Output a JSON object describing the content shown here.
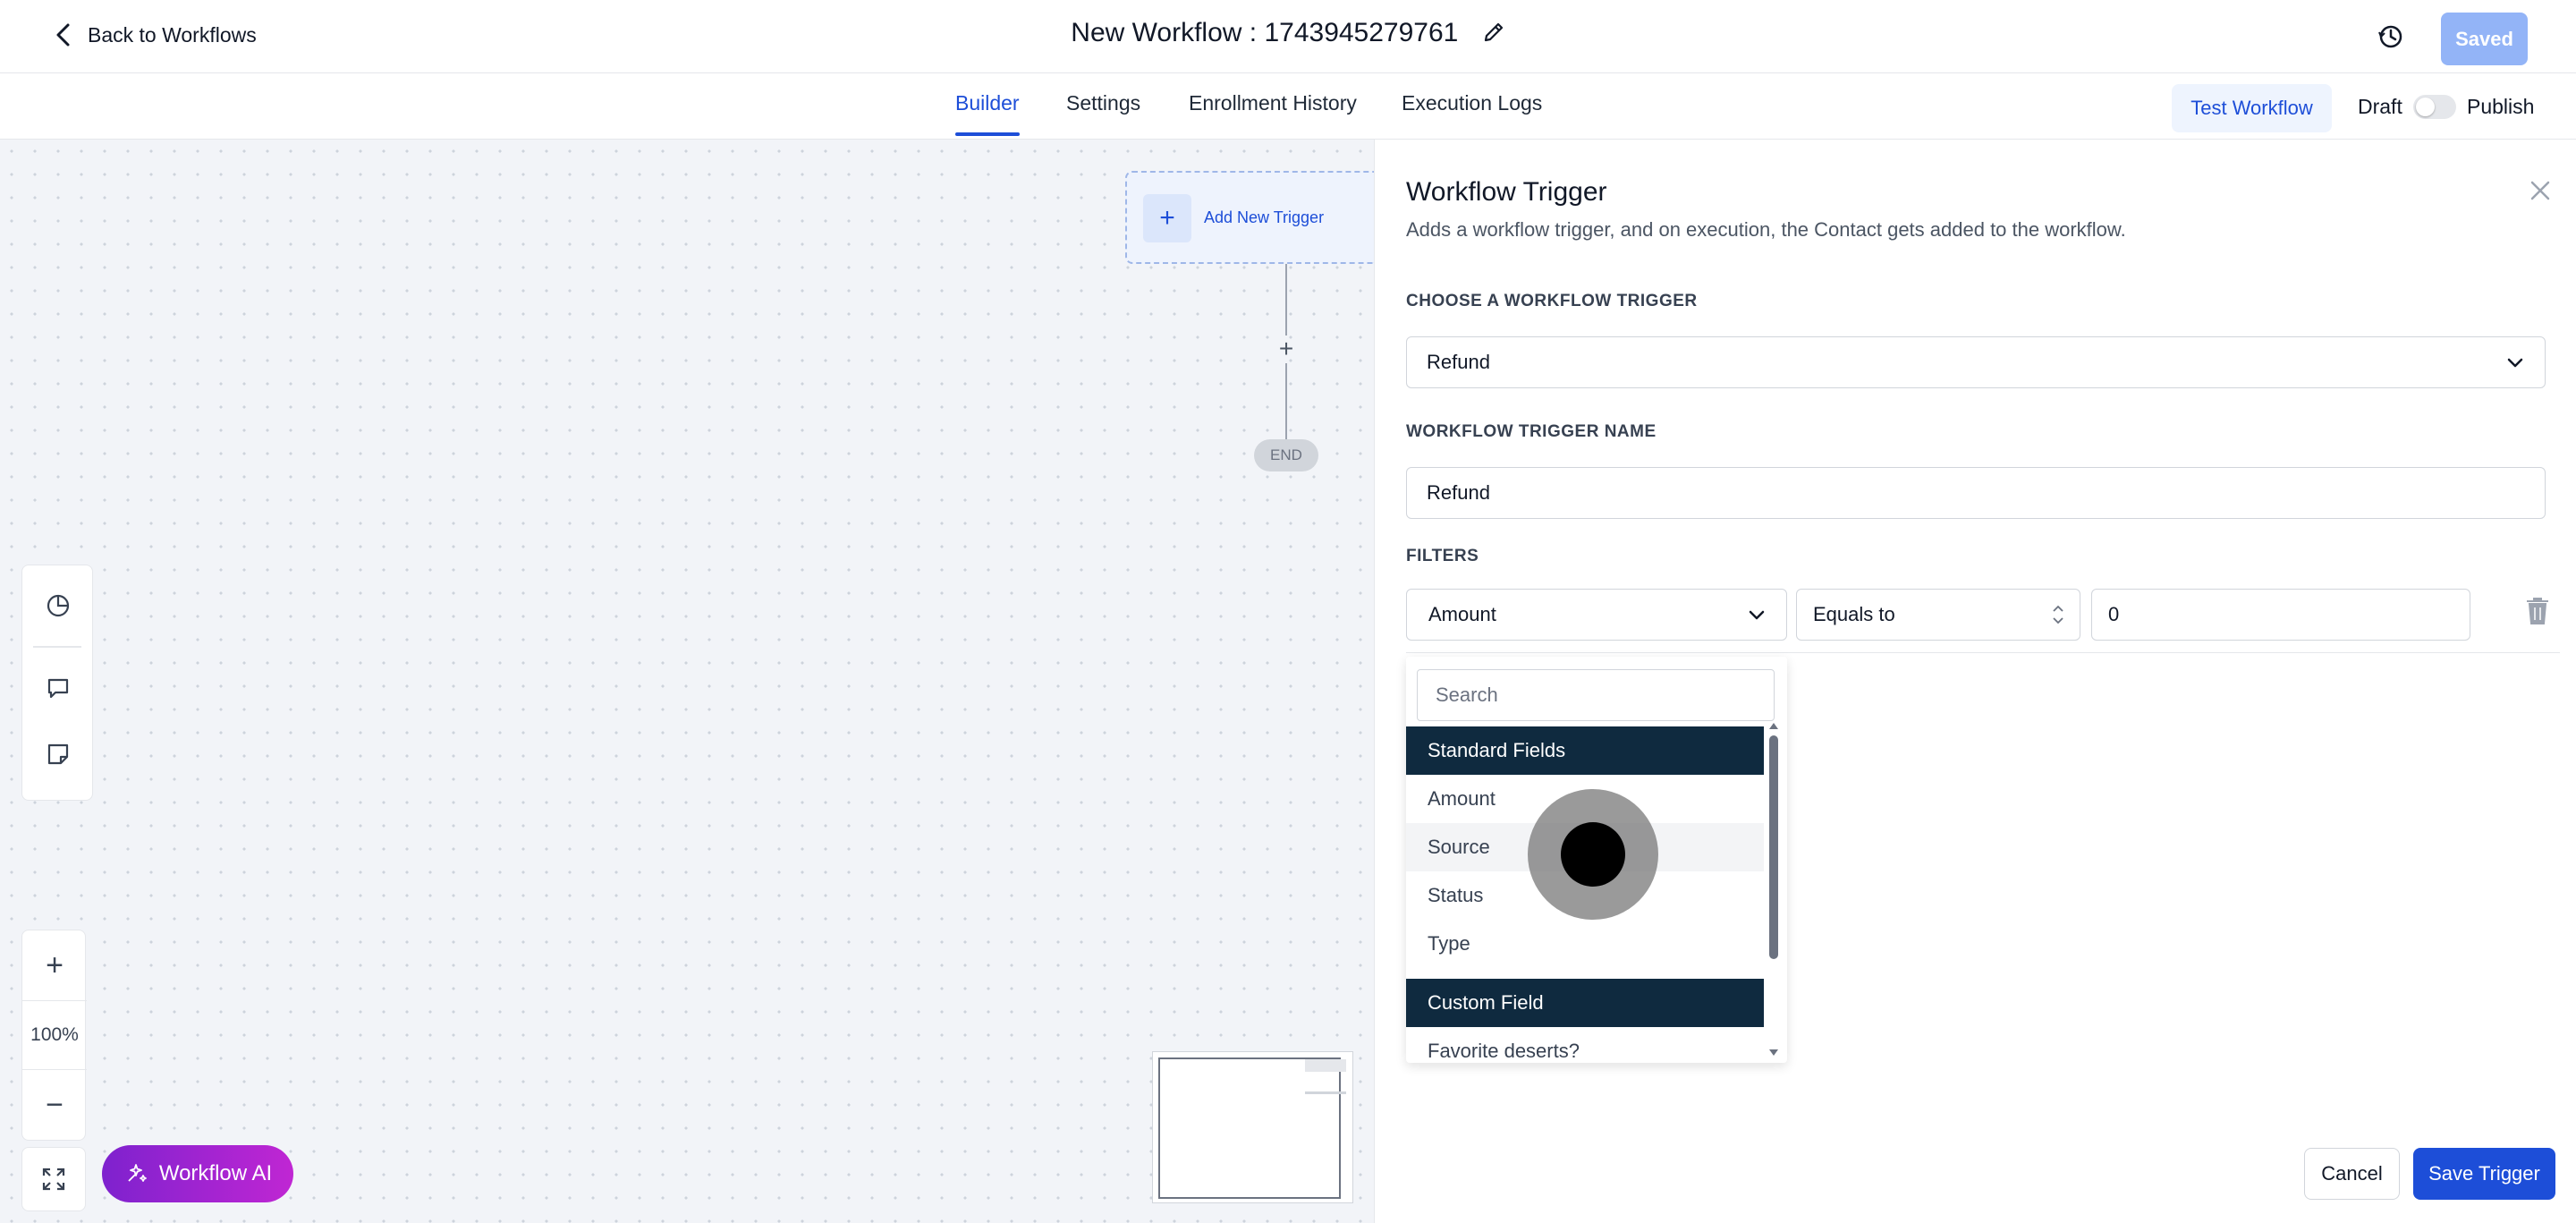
{
  "header": {
    "back_label": "Back to Workflows",
    "title": "New Workflow : 1743945279761",
    "saved_label": "Saved"
  },
  "tabs": [
    {
      "label": "Builder",
      "active": true
    },
    {
      "label": "Settings",
      "active": false
    },
    {
      "label": "Enrollment History",
      "active": false
    },
    {
      "label": "Execution Logs",
      "active": false
    }
  ],
  "actions": {
    "test_label": "Test Workflow",
    "draft_label": "Draft",
    "publish_label": "Publish",
    "publish_toggle_on": false
  },
  "canvas": {
    "add_trigger_label": "Add New Trigger",
    "end_label": "END",
    "zoom_level": "100%",
    "ai_label": "Workflow AI"
  },
  "panel": {
    "title": "Workflow Trigger",
    "subtitle": "Adds a workflow trigger, and on execution, the Contact gets added to the workflow.",
    "choose_label": "CHOOSE A WORKFLOW TRIGGER",
    "trigger_value": "Refund",
    "name_label": "WORKFLOW TRIGGER NAME",
    "name_value": "Refund",
    "filters_label": "FILTERS",
    "filter": {
      "field": "Amount",
      "operator": "Equals to",
      "value": "0"
    },
    "dropdown": {
      "search_placeholder": "Search",
      "group1": "Standard Fields",
      "items1": [
        "Amount",
        "Source",
        "Status",
        "Type"
      ],
      "group2": "Custom Field",
      "items2": [
        "Favorite deserts?"
      ]
    },
    "cancel_label": "Cancel",
    "save_label": "Save Trigger"
  },
  "colors": {
    "accent": "#1d4ed8",
    "group_header": "#0f2a3f",
    "ai_gradient_start": "#7e22ce",
    "ai_gradient_end": "#c026d3"
  }
}
